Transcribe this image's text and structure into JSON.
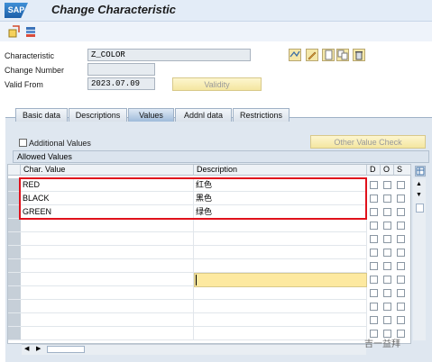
{
  "window": {
    "title": "Change Characteristic",
    "logo_text": "SAP"
  },
  "form": {
    "characteristic_label": "Characteristic",
    "characteristic_value": "Z_COLOR",
    "change_number_label": "Change Number",
    "change_number_value": "",
    "valid_from_label": "Valid From",
    "valid_from_value": "2023.07.09",
    "validity_button": "Validity"
  },
  "tabs": [
    {
      "label": "Basic data",
      "active": false
    },
    {
      "label": "Descriptions",
      "active": false
    },
    {
      "label": "Values",
      "active": true
    },
    {
      "label": "Addnl data",
      "active": false
    },
    {
      "label": "Restrictions",
      "active": false
    }
  ],
  "values_tab": {
    "additional_values_label": "Additional Values",
    "other_value_check_button": "Other Value Check",
    "group_title": "Allowed Values",
    "columns": {
      "char_value": "Char. Value",
      "description": "Description",
      "d": "D",
      "o": "O",
      "s": "S"
    },
    "rows": [
      {
        "char_value": "RED",
        "description": "红色"
      },
      {
        "char_value": "BLACK",
        "description": "黑色"
      },
      {
        "char_value": "GREEN",
        "description": "绿色"
      }
    ]
  },
  "watermark": "吉一益拜"
}
